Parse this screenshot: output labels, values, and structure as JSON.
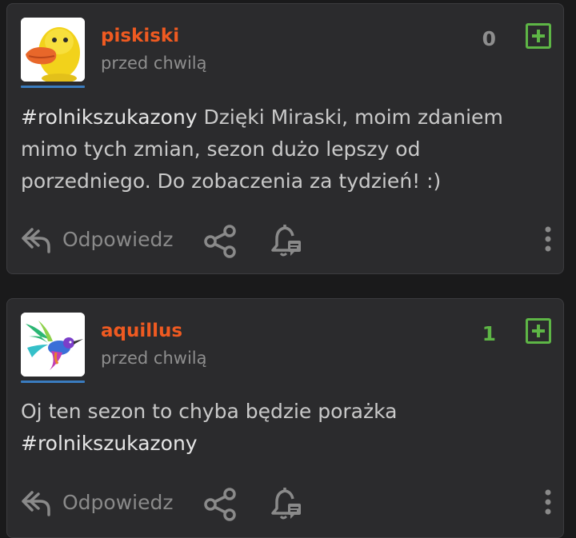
{
  "posts": [
    {
      "username": "piskiski",
      "time": "przed chwilą",
      "score": "0",
      "hashtag": "#rolnikszukazony",
      "text": " Dzięki Miraski, moim zdaniem mimo tych zmian, sezon dużo lepszy od porzedniego. Do zobaczenia za tydzień! :)",
      "reply_label": "Odpowiedz",
      "avatar_icon": "duck-avatar"
    },
    {
      "username": "aquillus",
      "time": "przed chwilą",
      "score": "1",
      "text_before": "Oj ten sezon to chyba będzie porażka ",
      "hashtag": "#rolnikszukazony",
      "reply_label": "Odpowiedz",
      "avatar_icon": "hummingbird-avatar"
    }
  ],
  "colors": {
    "background": "#1a1a1b",
    "card": "#2b2b2d",
    "username": "#ef5a21",
    "vote_green": "#5eb646",
    "avatar_underline": "#3a7cbf"
  }
}
